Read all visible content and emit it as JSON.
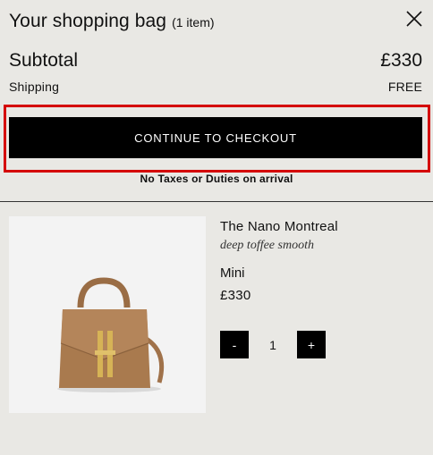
{
  "header": {
    "title": "Your shopping bag",
    "item_count": "(1 item)"
  },
  "summary": {
    "subtotal_label": "Subtotal",
    "subtotal_value": "£330",
    "shipping_label": "Shipping",
    "shipping_value": "FREE"
  },
  "checkout": {
    "button_label": "CONTINUE TO CHECKOUT",
    "duties_note": "No Taxes or Duties on arrival"
  },
  "item": {
    "name": "The Nano Montreal",
    "color": "deep toffee smooth",
    "size": "Mini",
    "price": "£330",
    "quantity": "1",
    "minus_label": "-",
    "plus_label": "+",
    "image_icon": "handbag-image"
  },
  "colors": {
    "background": "#e9e8e4",
    "button": "#000000",
    "highlight": "#d40000",
    "bag": "#a97a4e",
    "hardware": "#d6b356"
  }
}
